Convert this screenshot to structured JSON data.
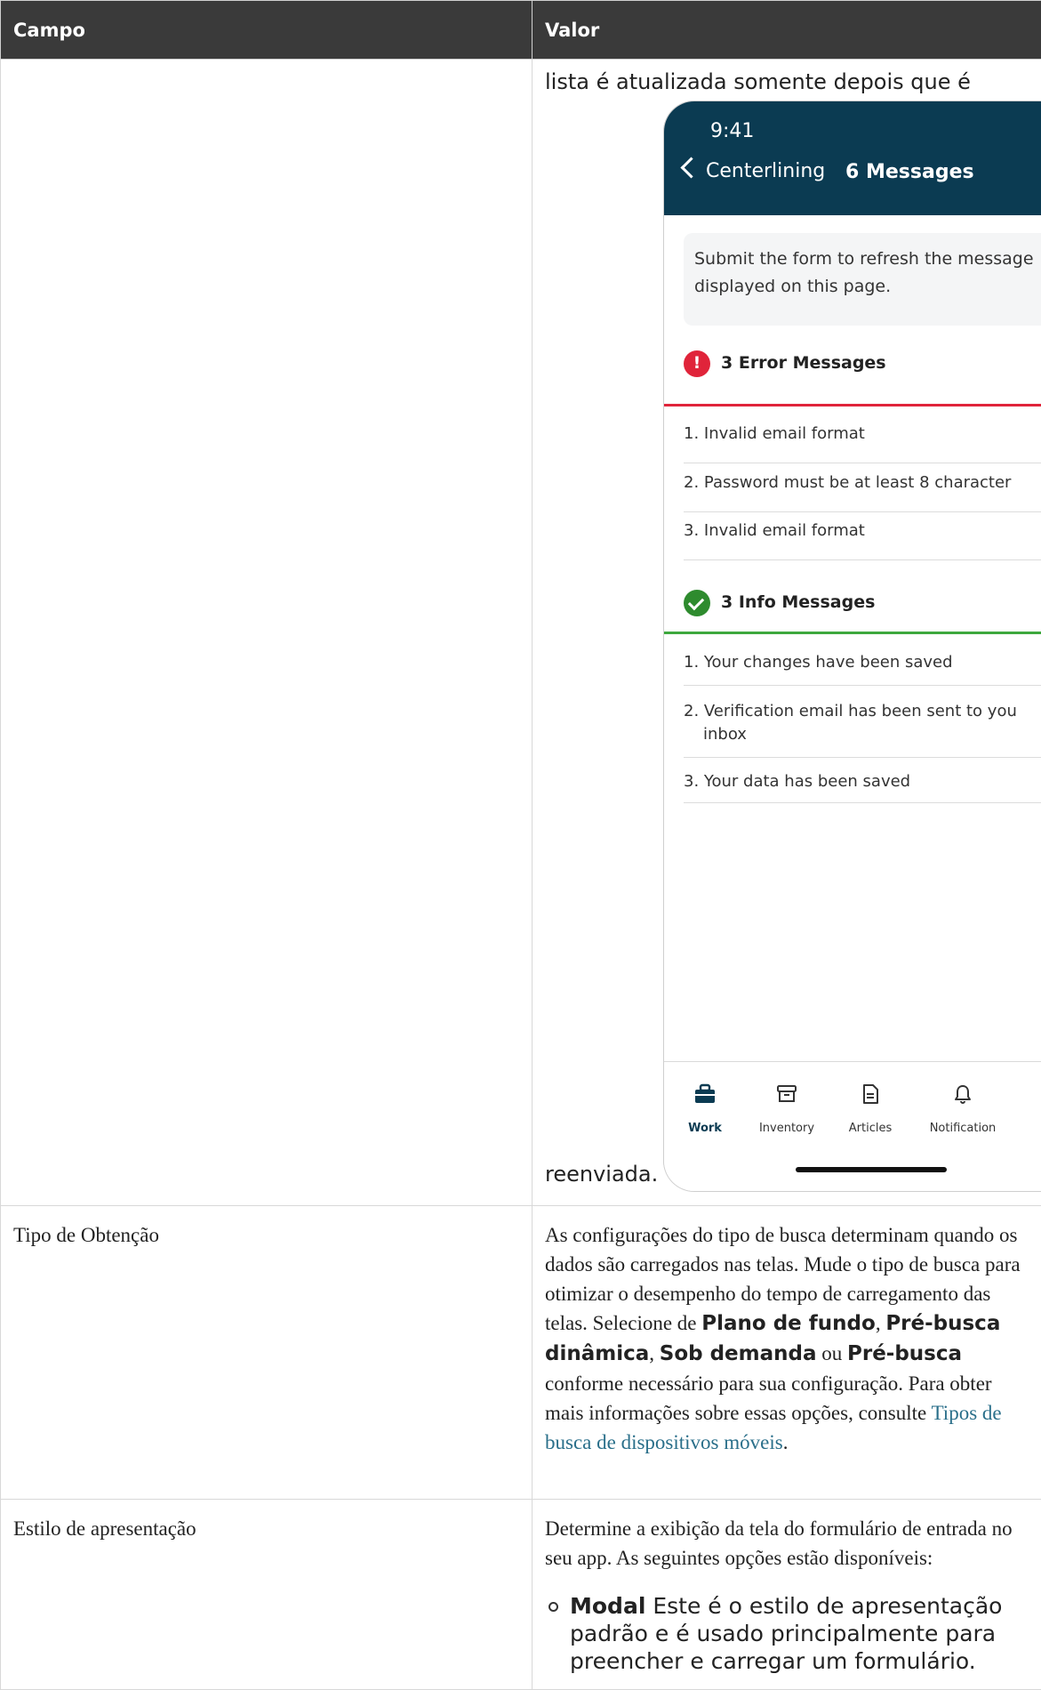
{
  "table": {
    "headers": [
      "Campo",
      "Valor"
    ],
    "rows": {
      "messages": {
        "lead_text": "lista é atualizada somente depois que é",
        "tail_text": "reenviada.",
        "phone": {
          "time": "9:41",
          "back_label": "Centerlining",
          "title": "6 Messages",
          "notice": "Submit the form to refresh the messages displayed on this page.",
          "notice_line1": "Submit the form to refresh the message",
          "notice_line2": "displayed on this page.",
          "error_heading": "3 Error Messages",
          "errors": [
            "1. Invalid email format",
            "2. Password must be at least 8 character",
            "3. Invalid email format"
          ],
          "info_heading": "3 Info Messages",
          "infos": [
            "1. Your changes have been saved",
            "2. Verification email has been sent to you",
            "inbox",
            "3. Your data has been saved"
          ],
          "tabs": [
            "Work",
            "Inventory",
            "Articles",
            "Notification"
          ],
          "colors": {
            "header": "#0b3b52",
            "error": "#e0243a",
            "success": "#2e8b2e"
          }
        }
      },
      "fetch_type": {
        "field": "Tipo de Obtenção",
        "text_1": "As configurações do tipo de busca determinam quando os dados são carregados nas telas. Mude o tipo de busca para otimizar o desempenho do tempo de carregamento das telas. Selecione de",
        "opt_1": "Plano de fundo",
        "sep_1": ",",
        "opt_2": "Pré-busca dinâmica",
        "sep_2": ",",
        "opt_3": "Sob demanda",
        "text_or": "ou",
        "opt_4": "Pré-busca",
        "text_2": "conforme necessário para sua configuração. Para obter mais informações sobre essas opções, consulte",
        "link": "Tipos de busca de dispositivos móveis",
        "text_end": "."
      },
      "presentation": {
        "field": "Estilo de apresentação",
        "text": "Determine a exibição da tela do formulário de entrada no seu app. As seguintes opções estão disponíveis:",
        "option_label": "Modal",
        "option_text": "Este é o estilo de apresentação padrão e é usado principalmente para preencher e carregar um formulário."
      }
    }
  }
}
